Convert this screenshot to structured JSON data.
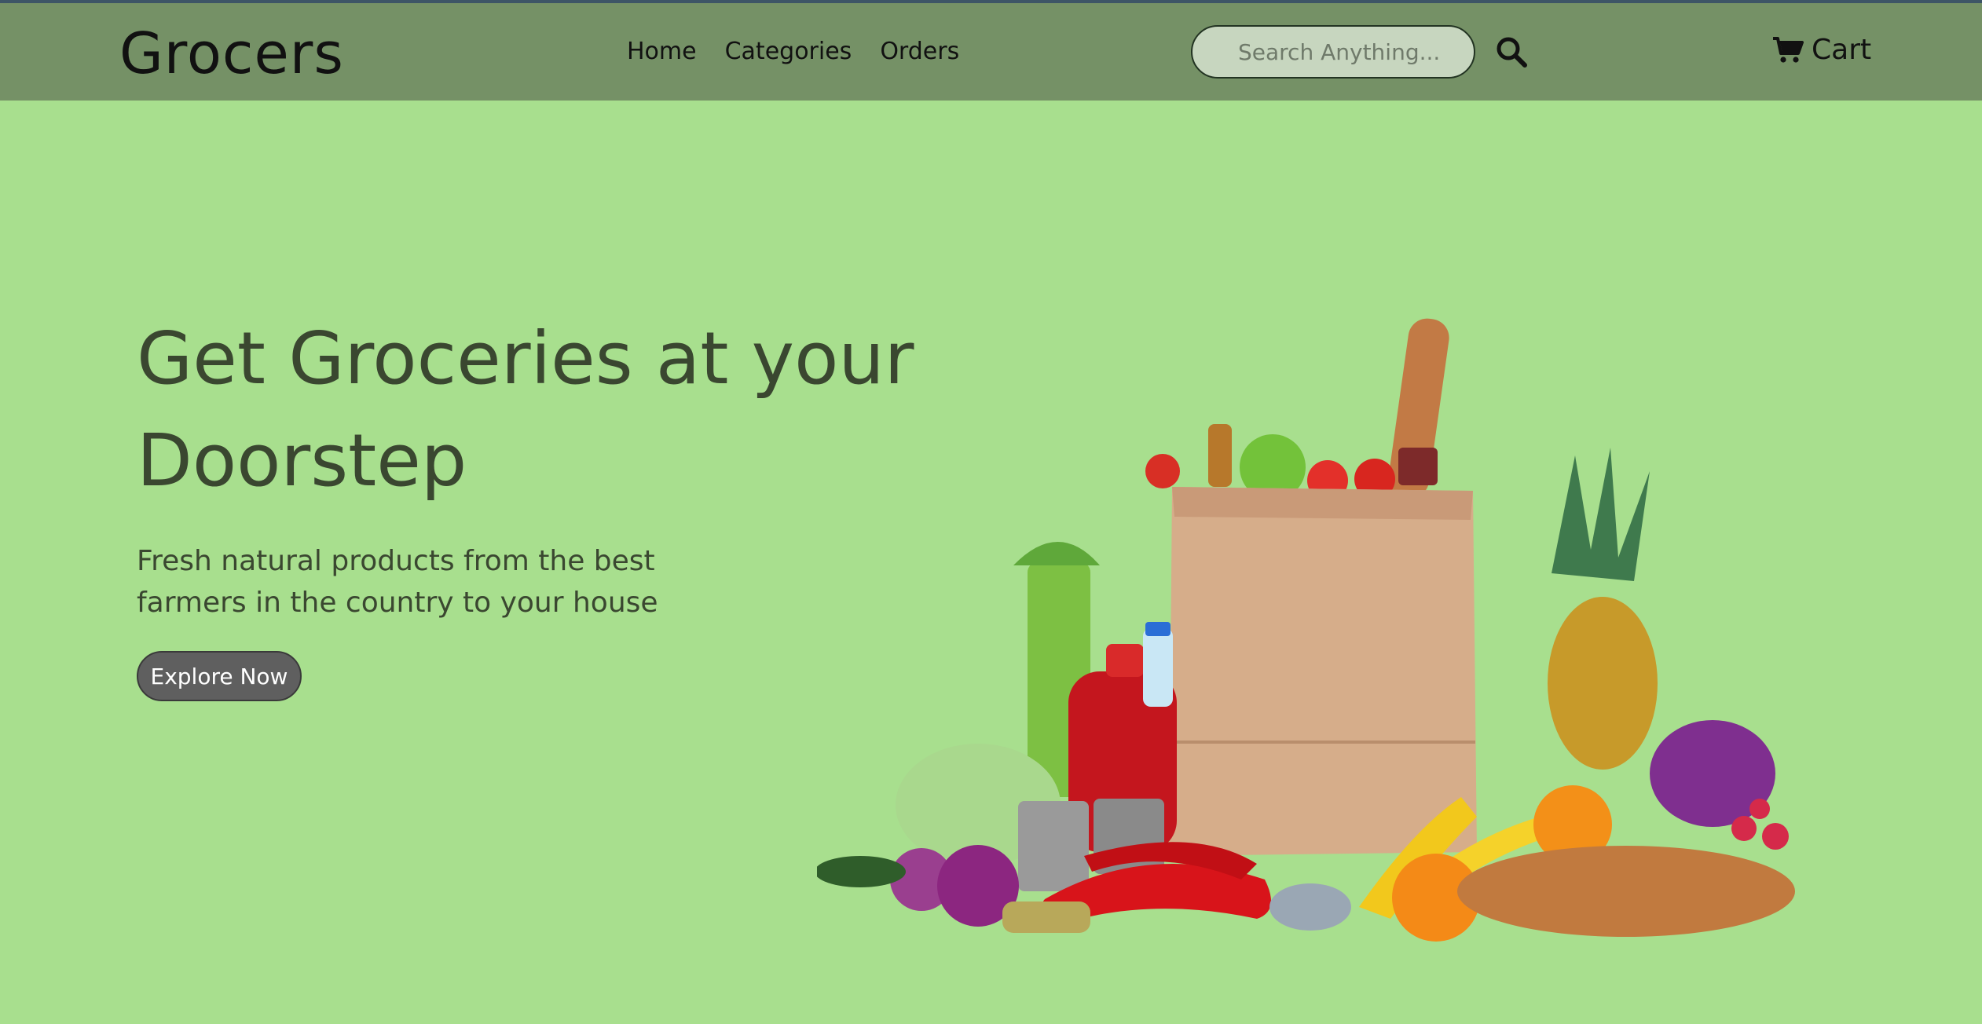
{
  "header": {
    "logo": "Grocers",
    "nav": [
      "Home",
      "Categories",
      "Orders"
    ],
    "search_placeholder": "Search Anything...",
    "cart_label": "Cart"
  },
  "hero": {
    "title": "Get Groceries at your Doorstep",
    "subtitle_line1": "Fresh natural products from the best",
    "subtitle_line2": "farmers in the country to your house",
    "cta_label": "Explore Now"
  },
  "colors": {
    "page_bg": "#a8df8e",
    "header_bg": "#759166",
    "title_text": "#3a4730",
    "button_bg": "#5f5f5f"
  },
  "icons": [
    "search-icon",
    "cart-icon"
  ]
}
